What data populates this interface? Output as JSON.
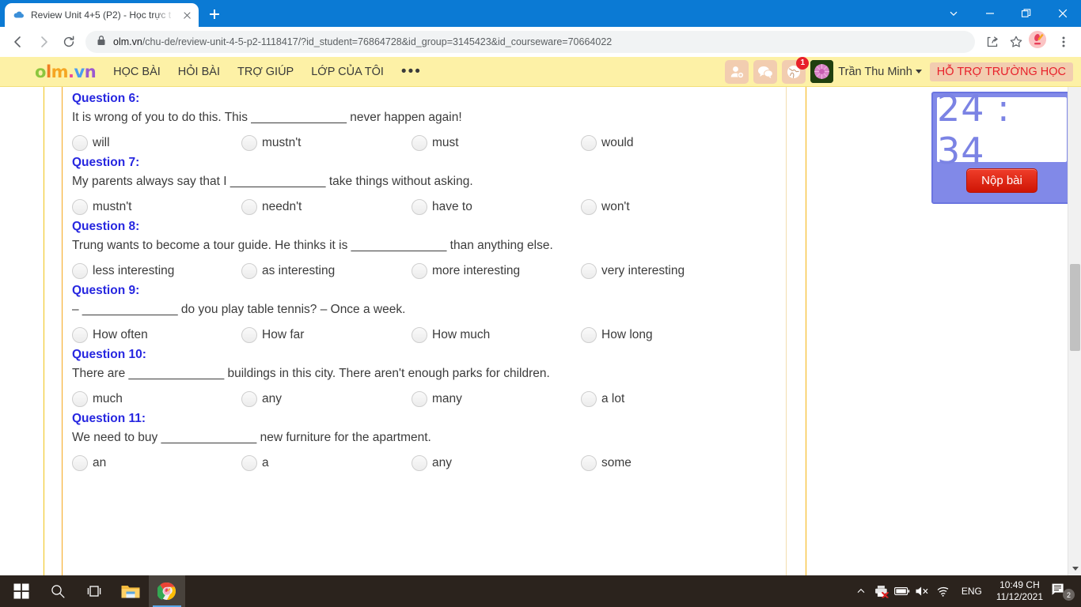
{
  "window": {
    "tab": {
      "title": "Review Unit 4+5 (P2) - Học trực t",
      "favicon": "cloud-icon"
    },
    "controls": {
      "tab_search": "chevron-down-icon",
      "minimize": "minimize-icon",
      "restore": "restore-icon",
      "close": "close-icon"
    }
  },
  "toolbar": {
    "back": "back-arrow-icon",
    "forward": "forward-arrow-icon",
    "reload": "reload-icon",
    "lock": "lock-icon",
    "url_host": "olm.vn",
    "url_path": "/chu-de/review-unit-4-5-p2-1118417/?id_student=76864728&id_group=3145423&id_courseware=70664022",
    "share": "share-icon",
    "bookmark": "star-icon",
    "profile": "profile-avatar",
    "menu": "three-dot-menu-icon"
  },
  "site_header": {
    "logo": [
      {
        "ch": "o",
        "color": "#8cc63e"
      },
      {
        "ch": "l",
        "color": "#f07d22"
      },
      {
        "ch": "m",
        "color": "#f5a623"
      },
      {
        "ch": ".",
        "color": "#ec4899"
      },
      {
        "ch": "v",
        "color": "#4a9df0"
      },
      {
        "ch": "n",
        "color": "#9b59d0"
      }
    ],
    "nav": [
      "HỌC BÀI",
      "HỎI BÀI",
      "TRỢ GIÚP",
      "LỚP CỦA TÔI"
    ],
    "more": "•••",
    "icons": [
      {
        "name": "add-friend-icon",
        "badge": null
      },
      {
        "name": "chat-icon",
        "badge": null
      },
      {
        "name": "globe-notifications-icon",
        "badge": "1"
      }
    ],
    "username": "Trần Thu Minh",
    "support_label": "HỖ TRỢ TRƯỜNG HỌC"
  },
  "timer": {
    "display": "24 : 34",
    "submit_label": "Nộp bài"
  },
  "quiz": {
    "questions": [
      {
        "heading": "Question 6:",
        "text": "It is wrong of you to do this. This ______________ never happen again!",
        "options": [
          "will",
          "mustn't",
          "must",
          "would"
        ]
      },
      {
        "heading": "Question 7:",
        "text": "My parents always say that I ______________ take things without asking.",
        "options": [
          "mustn't",
          "needn't",
          "have to",
          "won't"
        ]
      },
      {
        "heading": "Question 8:",
        "text": "Trung wants to become a tour guide. He thinks it is ______________ than anything else.",
        "options": [
          "less interesting",
          "as interesting",
          "more interesting",
          "very interesting"
        ]
      },
      {
        "heading": "Question 9:",
        "text": "– ______________ do you play table tennis? – Once a week.",
        "options": [
          "How often",
          "How far",
          "How much",
          "How long"
        ]
      },
      {
        "heading": "Question 10:",
        "text": "There are ______________ buildings in this city. There aren't enough parks for children.",
        "options": [
          "much",
          "any",
          "many",
          "a lot"
        ]
      },
      {
        "heading": "Question 11:",
        "text": "We need to buy ______________ new furniture for the apartment.",
        "options": [
          "an",
          "a",
          "any",
          "some"
        ]
      }
    ]
  },
  "taskbar": {
    "items": [
      {
        "name": "start-button",
        "icon": "windows-logo-icon",
        "active": false
      },
      {
        "name": "search-button",
        "icon": "search-icon",
        "active": false
      },
      {
        "name": "task-view-button",
        "icon": "task-view-icon",
        "active": false
      },
      {
        "name": "file-explorer-button",
        "icon": "folder-icon",
        "active": false
      },
      {
        "name": "chrome-button",
        "icon": "chrome-icon",
        "active": true
      }
    ],
    "tray": {
      "overflow": "chevron-up-icon",
      "printer": "printer-error-icon",
      "battery": "battery-icon",
      "volume": "volume-muted-icon",
      "network": "wifi-icon",
      "language": "ENG",
      "time": "10:49 CH",
      "date": "11/12/2021",
      "notifications_badge": "2"
    }
  },
  "colors": {
    "chrome_blue": "#0b7ad4",
    "site_yellow": "#fdf1a6",
    "question_blue": "#2727e0",
    "timer_purple": "#8189e8",
    "submit_red": "#e8202a",
    "rail_orange": "#f5b511"
  }
}
